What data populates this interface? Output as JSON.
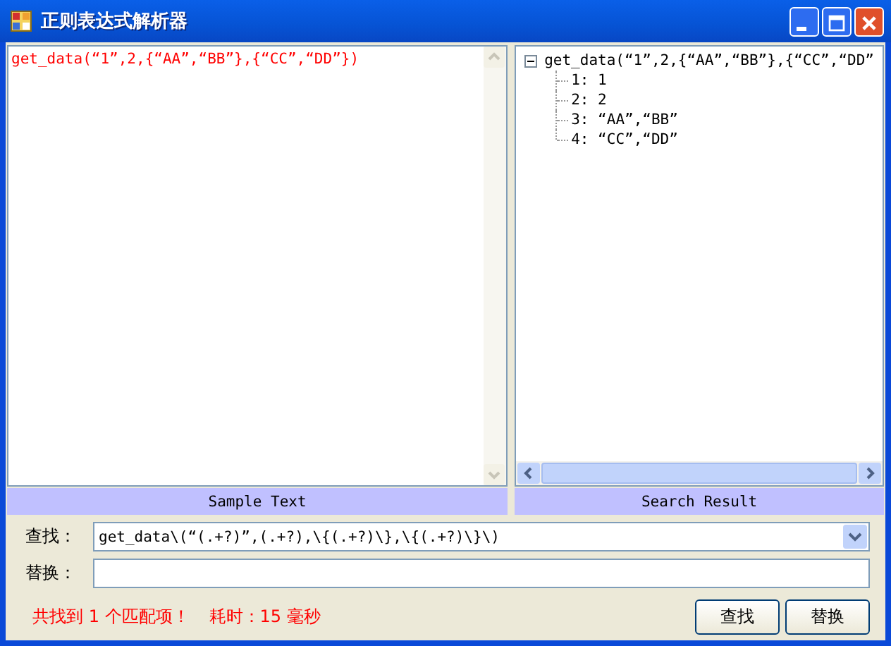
{
  "window": {
    "title": "正则表达式解析器"
  },
  "sample": {
    "text": "get_data(“1”,2,{“AA”,“BB”},{“CC”,“DD”})",
    "label": "Sample Text"
  },
  "result": {
    "label": "Search Result",
    "tree": [
      {
        "label": "get_data(“1”,2,{“AA”,“BB”},{“CC”,“DD”",
        "expanded": true,
        "children": [
          {
            "label": "1: 1"
          },
          {
            "label": "2: 2"
          },
          {
            "label": "3: “AA”,“BB”"
          },
          {
            "label": "4: “CC”,“DD”"
          }
        ]
      }
    ]
  },
  "find": {
    "label": "查找：",
    "value": "get_data\\(“(.+?)”,(.+?),\\{(.+?)\\},\\{(.+?)\\}\\)"
  },
  "replace": {
    "label": "替换："
  },
  "status": {
    "matches": "共找到 1 个匹配项！",
    "time": "耗时：15 毫秒"
  },
  "buttons": [
    "查找",
    "替换"
  ]
}
